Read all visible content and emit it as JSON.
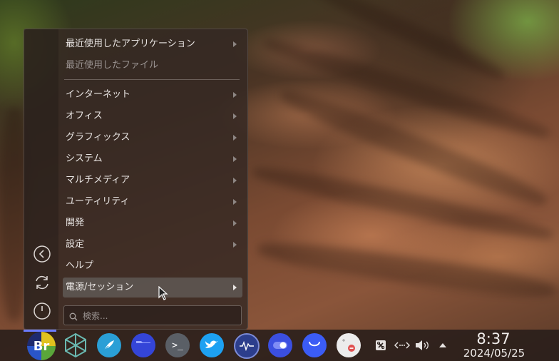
{
  "menu": {
    "items": [
      {
        "label": "最近使用したアプリケーション",
        "submenu": true,
        "disabled": false
      },
      {
        "label": "最近使用したファイル",
        "submenu": false,
        "disabled": true
      },
      {
        "label": "インターネット",
        "submenu": true,
        "disabled": false
      },
      {
        "label": "オフィス",
        "submenu": true,
        "disabled": false
      },
      {
        "label": "グラフィックス",
        "submenu": true,
        "disabled": false
      },
      {
        "label": "システム",
        "submenu": true,
        "disabled": false
      },
      {
        "label": "マルチメディア",
        "submenu": true,
        "disabled": false
      },
      {
        "label": "ユーティリティ",
        "submenu": true,
        "disabled": false
      },
      {
        "label": "開発",
        "submenu": true,
        "disabled": false
      },
      {
        "label": "設定",
        "submenu": true,
        "disabled": false
      },
      {
        "label": "ヘルプ",
        "submenu": false,
        "disabled": false
      },
      {
        "label": "電源/セッション",
        "submenu": true,
        "disabled": false,
        "highlighted": true
      }
    ],
    "side_buttons": [
      "back-icon",
      "refresh-icon",
      "power-icon"
    ],
    "search": {
      "placeholder": "検索..."
    }
  },
  "taskbar": {
    "apps": [
      {
        "name": "bridge-app-icon",
        "text": "Br",
        "color": "#1e2a6e"
      },
      {
        "name": "network-graph-app-icon",
        "color": "#3a6a6a"
      },
      {
        "name": "feather-app-icon",
        "color": "#2a9fd6"
      },
      {
        "name": "file-manager-app-icon",
        "color": "#3445d8"
      },
      {
        "name": "terminal-app-icon",
        "text": ">_",
        "color": "#5a5f66"
      },
      {
        "name": "bird-app-icon",
        "color": "#1da1f2"
      },
      {
        "name": "system-monitor-app-icon",
        "color": "#2c3e8c"
      },
      {
        "name": "toggle-app-icon",
        "color": "#3b4fe0"
      },
      {
        "name": "store-app-icon",
        "color": "#3b5cf5"
      },
      {
        "name": "screenshot-app-icon",
        "color": "#e8e8e8"
      }
    ],
    "tray": [
      "clipboard-icon",
      "network-icon",
      "volume-icon",
      "tray-expand-icon"
    ],
    "clock": {
      "time": "8:37",
      "date": "2024/05/25"
    }
  }
}
